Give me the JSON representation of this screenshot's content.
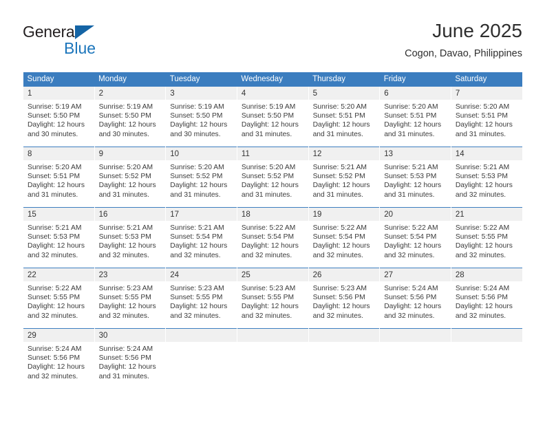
{
  "logo": {
    "text_top": "General",
    "text_bottom": "Blue",
    "triangle_color": "#1464a5",
    "blue_color": "#1b75bb"
  },
  "header": {
    "title": "June 2025",
    "subtitle": "Cogon, Davao, Philippines"
  },
  "theme": {
    "header_bg": "#3b7dbf",
    "header_text": "#ffffff",
    "daynum_bg": "#f0f0f0",
    "cell_text": "#3a3a3a"
  },
  "weekdays": [
    "Sunday",
    "Monday",
    "Tuesday",
    "Wednesday",
    "Thursday",
    "Friday",
    "Saturday"
  ],
  "weeks": [
    [
      {
        "day": "1",
        "sunrise": "Sunrise: 5:19 AM",
        "sunset": "Sunset: 5:50 PM",
        "daylight": "Daylight: 12 hours and 30 minutes."
      },
      {
        "day": "2",
        "sunrise": "Sunrise: 5:19 AM",
        "sunset": "Sunset: 5:50 PM",
        "daylight": "Daylight: 12 hours and 30 minutes."
      },
      {
        "day": "3",
        "sunrise": "Sunrise: 5:19 AM",
        "sunset": "Sunset: 5:50 PM",
        "daylight": "Daylight: 12 hours and 30 minutes."
      },
      {
        "day": "4",
        "sunrise": "Sunrise: 5:19 AM",
        "sunset": "Sunset: 5:50 PM",
        "daylight": "Daylight: 12 hours and 31 minutes."
      },
      {
        "day": "5",
        "sunrise": "Sunrise: 5:20 AM",
        "sunset": "Sunset: 5:51 PM",
        "daylight": "Daylight: 12 hours and 31 minutes."
      },
      {
        "day": "6",
        "sunrise": "Sunrise: 5:20 AM",
        "sunset": "Sunset: 5:51 PM",
        "daylight": "Daylight: 12 hours and 31 minutes."
      },
      {
        "day": "7",
        "sunrise": "Sunrise: 5:20 AM",
        "sunset": "Sunset: 5:51 PM",
        "daylight": "Daylight: 12 hours and 31 minutes."
      }
    ],
    [
      {
        "day": "8",
        "sunrise": "Sunrise: 5:20 AM",
        "sunset": "Sunset: 5:51 PM",
        "daylight": "Daylight: 12 hours and 31 minutes."
      },
      {
        "day": "9",
        "sunrise": "Sunrise: 5:20 AM",
        "sunset": "Sunset: 5:52 PM",
        "daylight": "Daylight: 12 hours and 31 minutes."
      },
      {
        "day": "10",
        "sunrise": "Sunrise: 5:20 AM",
        "sunset": "Sunset: 5:52 PM",
        "daylight": "Daylight: 12 hours and 31 minutes."
      },
      {
        "day": "11",
        "sunrise": "Sunrise: 5:20 AM",
        "sunset": "Sunset: 5:52 PM",
        "daylight": "Daylight: 12 hours and 31 minutes."
      },
      {
        "day": "12",
        "sunrise": "Sunrise: 5:21 AM",
        "sunset": "Sunset: 5:52 PM",
        "daylight": "Daylight: 12 hours and 31 minutes."
      },
      {
        "day": "13",
        "sunrise": "Sunrise: 5:21 AM",
        "sunset": "Sunset: 5:53 PM",
        "daylight": "Daylight: 12 hours and 31 minutes."
      },
      {
        "day": "14",
        "sunrise": "Sunrise: 5:21 AM",
        "sunset": "Sunset: 5:53 PM",
        "daylight": "Daylight: 12 hours and 32 minutes."
      }
    ],
    [
      {
        "day": "15",
        "sunrise": "Sunrise: 5:21 AM",
        "sunset": "Sunset: 5:53 PM",
        "daylight": "Daylight: 12 hours and 32 minutes."
      },
      {
        "day": "16",
        "sunrise": "Sunrise: 5:21 AM",
        "sunset": "Sunset: 5:53 PM",
        "daylight": "Daylight: 12 hours and 32 minutes."
      },
      {
        "day": "17",
        "sunrise": "Sunrise: 5:21 AM",
        "sunset": "Sunset: 5:54 PM",
        "daylight": "Daylight: 12 hours and 32 minutes."
      },
      {
        "day": "18",
        "sunrise": "Sunrise: 5:22 AM",
        "sunset": "Sunset: 5:54 PM",
        "daylight": "Daylight: 12 hours and 32 minutes."
      },
      {
        "day": "19",
        "sunrise": "Sunrise: 5:22 AM",
        "sunset": "Sunset: 5:54 PM",
        "daylight": "Daylight: 12 hours and 32 minutes."
      },
      {
        "day": "20",
        "sunrise": "Sunrise: 5:22 AM",
        "sunset": "Sunset: 5:54 PM",
        "daylight": "Daylight: 12 hours and 32 minutes."
      },
      {
        "day": "21",
        "sunrise": "Sunrise: 5:22 AM",
        "sunset": "Sunset: 5:55 PM",
        "daylight": "Daylight: 12 hours and 32 minutes."
      }
    ],
    [
      {
        "day": "22",
        "sunrise": "Sunrise: 5:22 AM",
        "sunset": "Sunset: 5:55 PM",
        "daylight": "Daylight: 12 hours and 32 minutes."
      },
      {
        "day": "23",
        "sunrise": "Sunrise: 5:23 AM",
        "sunset": "Sunset: 5:55 PM",
        "daylight": "Daylight: 12 hours and 32 minutes."
      },
      {
        "day": "24",
        "sunrise": "Sunrise: 5:23 AM",
        "sunset": "Sunset: 5:55 PM",
        "daylight": "Daylight: 12 hours and 32 minutes."
      },
      {
        "day": "25",
        "sunrise": "Sunrise: 5:23 AM",
        "sunset": "Sunset: 5:55 PM",
        "daylight": "Daylight: 12 hours and 32 minutes."
      },
      {
        "day": "26",
        "sunrise": "Sunrise: 5:23 AM",
        "sunset": "Sunset: 5:56 PM",
        "daylight": "Daylight: 12 hours and 32 minutes."
      },
      {
        "day": "27",
        "sunrise": "Sunrise: 5:24 AM",
        "sunset": "Sunset: 5:56 PM",
        "daylight": "Daylight: 12 hours and 32 minutes."
      },
      {
        "day": "28",
        "sunrise": "Sunrise: 5:24 AM",
        "sunset": "Sunset: 5:56 PM",
        "daylight": "Daylight: 12 hours and 32 minutes."
      }
    ],
    [
      {
        "day": "29",
        "sunrise": "Sunrise: 5:24 AM",
        "sunset": "Sunset: 5:56 PM",
        "daylight": "Daylight: 12 hours and 32 minutes."
      },
      {
        "day": "30",
        "sunrise": "Sunrise: 5:24 AM",
        "sunset": "Sunset: 5:56 PM",
        "daylight": "Daylight: 12 hours and 31 minutes."
      },
      {
        "day": "",
        "sunrise": "",
        "sunset": "",
        "daylight": ""
      },
      {
        "day": "",
        "sunrise": "",
        "sunset": "",
        "daylight": ""
      },
      {
        "day": "",
        "sunrise": "",
        "sunset": "",
        "daylight": ""
      },
      {
        "day": "",
        "sunrise": "",
        "sunset": "",
        "daylight": ""
      },
      {
        "day": "",
        "sunrise": "",
        "sunset": "",
        "daylight": ""
      }
    ]
  ]
}
